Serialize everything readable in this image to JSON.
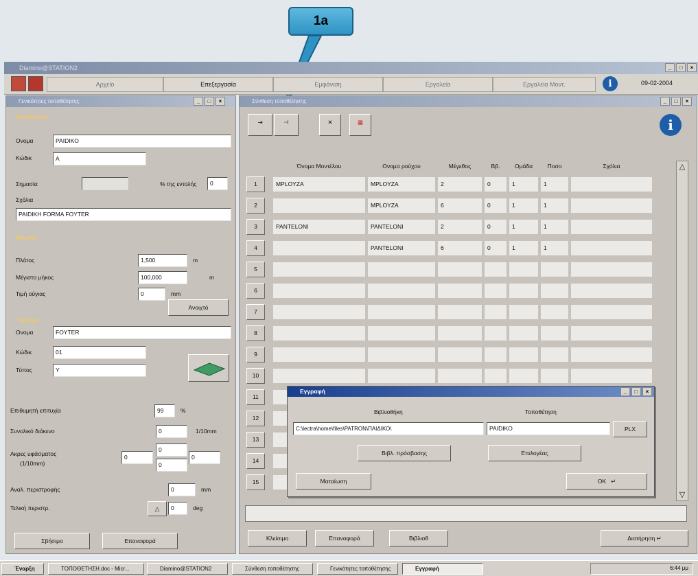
{
  "callout": "1a",
  "app": {
    "title": "Diamino@STATION2",
    "date": "09-02-2004"
  },
  "menu": [
    "Αρχείο",
    "Επεξεργασία",
    "Εμφάνιση",
    "Εργαλεία",
    "Εργαλεία Μοντ."
  ],
  "left": {
    "title": "Γενικότητες τοποθέτησης",
    "sec1": "Τοποθέτηση",
    "name_label": "Ονομα",
    "name_value": "PAIDIKO",
    "code_label": "Κώδικ",
    "code_value": "A",
    "mark_label": "Σημασία",
    "order_label": "% της εντολής",
    "order_value": "0",
    "comment_label": "Σχόλια",
    "comment_value": "PAIDIKH FORMA FOYTER",
    "sec2": "Μέγεθος",
    "width_label": "Πλάτος",
    "width_value": "1,500",
    "width_unit": "m",
    "maxlen_label": "Μέγιστο μήκος",
    "maxlen_value": "100,000",
    "maxlen_unit": "m",
    "joint_label": "Τιμή ούγιας",
    "joint_value": "0",
    "joint_unit": "mm",
    "sec3": "Ύφασμα",
    "open_button": "Ανοιχτό",
    "fname_label": "Ονομα",
    "fname_value": "FOYTER",
    "fcode_label": "Κώδικ",
    "fcode_value": "01",
    "ftype_label": "Τύπος",
    "ftype_value": "Y",
    "eff_label": "Επιθυμητή επιτυχία",
    "eff_value": "99",
    "eff_unit": "%",
    "gap_label": "Συνολικό διάκενο",
    "gap_value": "0",
    "gap_unit": "1/10mm",
    "edges_label": "Ακρες υφάσματος",
    "edges_unit": "(1/10mm)",
    "edge_left": "0",
    "edge_top": "0",
    "edge_bottom": "0",
    "edge_right": "0",
    "rot_label": "Αναλ. περιστροφής",
    "rot_value": "0",
    "rot_unit": "mm",
    "finrot_label": "Τελική περιστρ.",
    "finrot_value": "0",
    "finrot_unit": "deg",
    "erase_button": "Σβήσιμο",
    "reset_button": "Επαναφορά"
  },
  "right": {
    "title": "Σύνθεση τοποθέτησης",
    "headers": [
      "Όνομα Μοντέλου",
      "Ονομα ρούχου",
      "Μέγεθος",
      "Ββ.",
      "Ομάδα",
      "Ποσο",
      "Σχόλια"
    ],
    "rows": [
      [
        "1",
        "MPLOYZA",
        "MPLOYZA",
        "2",
        "0",
        "1",
        "1",
        ""
      ],
      [
        "2",
        "",
        "MPLOYZA",
        "6",
        "0",
        "1",
        "1",
        ""
      ],
      [
        "3",
        "PANTELONI",
        "PANTELONI",
        "2",
        "0",
        "1",
        "1",
        ""
      ],
      [
        "4",
        "",
        "PANTELONI",
        "6",
        "0",
        "1",
        "1",
        ""
      ],
      [
        "5",
        "",
        "",
        "",
        "",
        "",
        "",
        ""
      ],
      [
        "6",
        "",
        "",
        "",
        "",
        "",
        "",
        ""
      ],
      [
        "7",
        "",
        "",
        "",
        "",
        "",
        "",
        ""
      ],
      [
        "8",
        "",
        "",
        "",
        "",
        "",
        "",
        ""
      ],
      [
        "9",
        "",
        "",
        "",
        "",
        "",
        "",
        ""
      ],
      [
        "10",
        "",
        "",
        "",
        "",
        "",
        "",
        ""
      ],
      [
        "11",
        "",
        "",
        "",
        "",
        "",
        "",
        ""
      ],
      [
        "12",
        "",
        "",
        "",
        "",
        "",
        "",
        ""
      ],
      [
        "13",
        "",
        "",
        "",
        "",
        "",
        "",
        ""
      ],
      [
        "14",
        "",
        "",
        "",
        "",
        "",
        "",
        ""
      ],
      [
        "15",
        "",
        "",
        "",
        "",
        "",
        "",
        ""
      ]
    ],
    "close_button": "Κλείσιμο",
    "reset_button": "Επαναφορά",
    "lib_button": "Βιβλιοθ",
    "keep_button": "Διατήρηση"
  },
  "dialog": {
    "title": "Εγγραφή",
    "lib_label": "Βιβλιοθήκη",
    "place_label": "Τοποθέτηση",
    "path_value": "C:\\lectra\\home\\files\\PATRON\\ΠΑΙΔΙΚΟ\\",
    "place_value": "PAIDIKO",
    "ext": "PLX",
    "access_button": "Βιβλ. πρόσβασης",
    "select_button": "Επιλογέας",
    "cancel_button": "Ματαίωση",
    "ok_button": "OK"
  },
  "taskbar": {
    "start": "Έναρξη",
    "items": [
      "ΤΟΠΟΘΕΤΗΣΗ.doc - Micr...",
      "Diamino@STATION2",
      "Σύνθεση τοποθέτησης",
      "Γενικότητες τοποθέτησης",
      "Εγγραφή"
    ],
    "clock": "6:44 μμ"
  }
}
